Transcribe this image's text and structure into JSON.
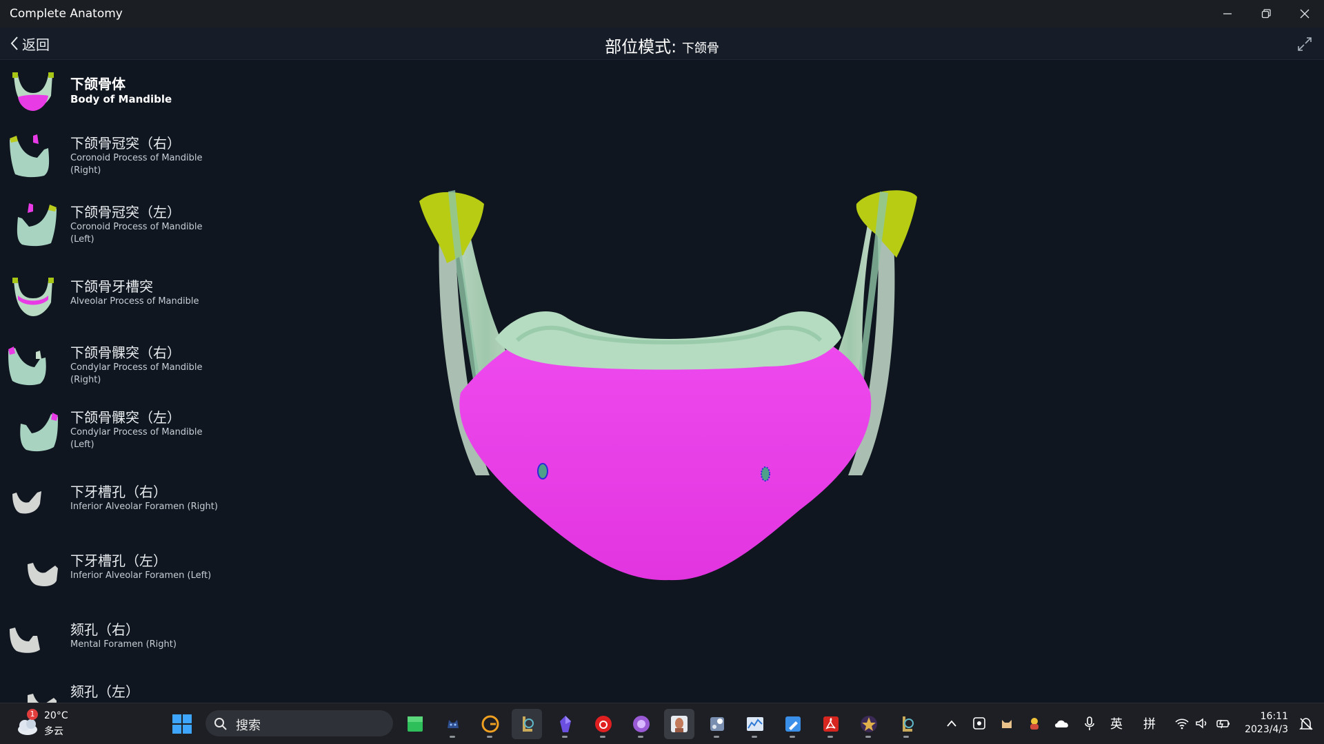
{
  "window": {
    "title": "Complete Anatomy"
  },
  "header": {
    "back_label": "返回",
    "mode_label": "部位模式:",
    "mode_value": "下颌骨"
  },
  "parts": [
    {
      "cn": "下颌骨体",
      "en": "Body of Mandible",
      "selected": true
    },
    {
      "cn": "下颌骨冠突（右）",
      "en": "Coronoid Process of Mandible (Right)"
    },
    {
      "cn": "下颌骨冠突（左）",
      "en": "Coronoid Process of Mandible (Left)"
    },
    {
      "cn": "下颌骨牙槽突",
      "en": "Alveolar Process of Mandible"
    },
    {
      "cn": "下颌骨髁突（右）",
      "en": "Condylar Process of Mandible (Right)"
    },
    {
      "cn": "下颌骨髁突（左）",
      "en": "Condylar Process of Mandible (Left)"
    },
    {
      "cn": "下牙槽孔（右）",
      "en": "Inferior Alveolar Foramen (Right)"
    },
    {
      "cn": "下牙槽孔（左）",
      "en": "Inferior Alveolar Foramen (Left)"
    },
    {
      "cn": "颏孔（右）",
      "en": "Mental Foramen (Right)"
    },
    {
      "cn": "颏孔（左）",
      "en": ""
    }
  ],
  "colors": {
    "selected_part": "#e83be6",
    "bone": "#b9dcc4",
    "condyle_highlight": "#b8cc14",
    "background": "#0f1620"
  },
  "taskbar": {
    "weather": {
      "temp": "20°C",
      "condition": "多云",
      "badge": "1"
    },
    "search_placeholder": "搜索",
    "apps": [
      "minecraft-icon",
      "game-icon",
      "grammarly-icon",
      "league-client-icon",
      "crystal-icon",
      "netease-music-icon",
      "app-icon",
      "complete-anatomy-icon",
      "steam-icon",
      "chart-app-icon",
      "editor-icon",
      "acrobat-icon",
      "game-launcher-icon",
      "league-icon"
    ],
    "tray": {
      "ime_lang": "英",
      "ime_mode": "拼"
    },
    "clock": {
      "time": "16:11",
      "date": "2023/4/3"
    }
  }
}
